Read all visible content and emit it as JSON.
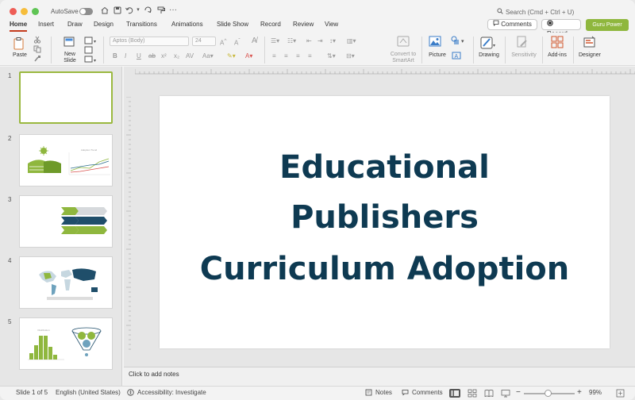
{
  "titlebar": {
    "autosave": "AutoSave",
    "search": "Search (Cmd + Ctrl + U)"
  },
  "tabs": [
    {
      "label": "Home",
      "active": true
    },
    {
      "label": "Insert"
    },
    {
      "label": "Draw"
    },
    {
      "label": "Design"
    },
    {
      "label": "Transitions"
    },
    {
      "label": "Animations"
    },
    {
      "label": "Slide Show"
    },
    {
      "label": "Record"
    },
    {
      "label": "Review"
    },
    {
      "label": "View"
    }
  ],
  "header_actions": {
    "comments": "Comments",
    "record": "Record",
    "guru": "Guru Power"
  },
  "ribbon": {
    "paste": "Paste",
    "new_slide": "New\nSlide",
    "font_name": "Aptos (Body)",
    "font_size": "24",
    "convert_smartart": "Convert to\nSmartArt",
    "picture": "Picture",
    "drawing": "Drawing",
    "sensitivity": "Sensitivity",
    "addins": "Add-ins",
    "designer": "Designer"
  },
  "slides": [
    {
      "number": "1"
    },
    {
      "number": "2",
      "chart_title": "Adoption Trend"
    },
    {
      "number": "3"
    },
    {
      "number": "4"
    },
    {
      "number": "5",
      "chart_title": "Distribution"
    }
  ],
  "main_slide": {
    "title_lines": [
      "Educational",
      "Publishers",
      "Curriculum Adoption"
    ]
  },
  "notes": {
    "placeholder": "Click to add notes"
  },
  "status": {
    "slide_of": "Slide 1 of 5",
    "language": "English (United States)",
    "accessibility": "Accessibility: Investigate",
    "notes": "Notes",
    "comments": "Comments",
    "zoom": "99%"
  },
  "colors": {
    "accent": "#c43b1d",
    "brand_green": "#8fb73e",
    "title_navy": "#0e3a52"
  }
}
